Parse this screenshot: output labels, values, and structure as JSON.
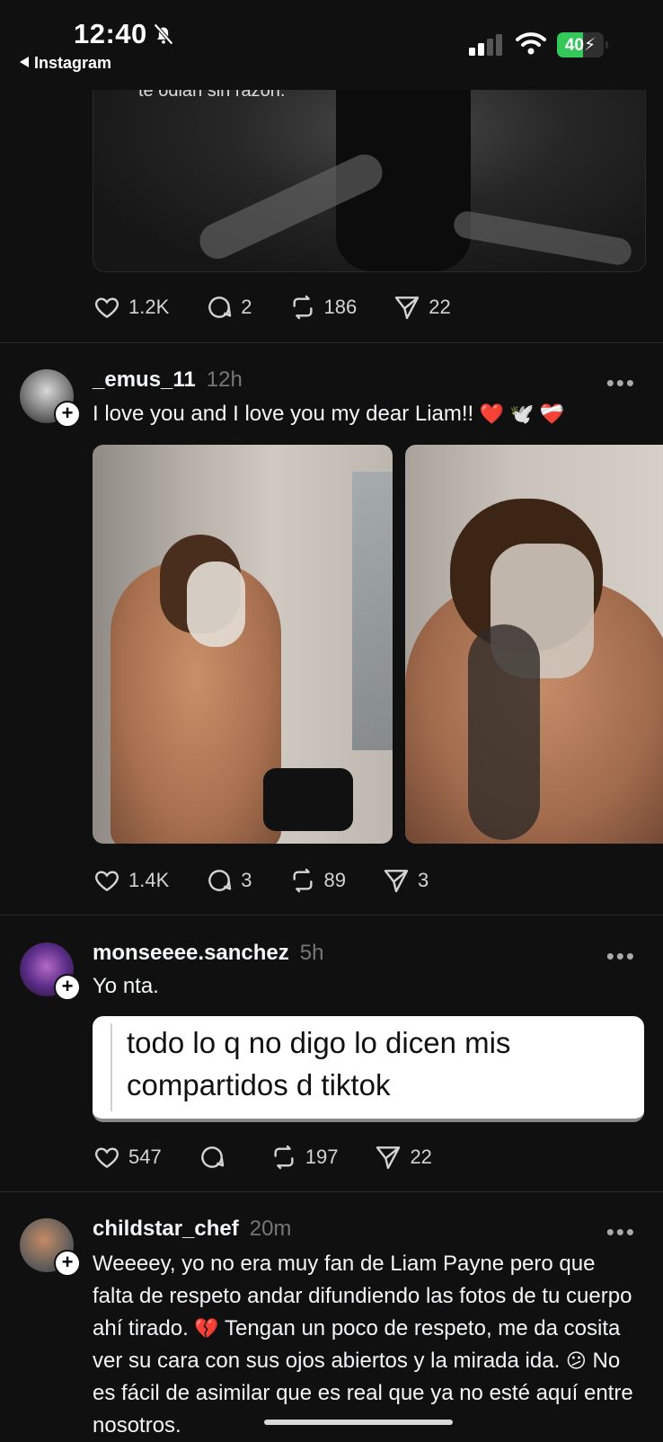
{
  "status_bar": {
    "time": "12:40",
    "back_label": "Instagram",
    "battery": "40"
  },
  "posts": [
    {
      "image_caption": "te odian sin razón.",
      "likes": "1.2K",
      "comments": "2",
      "reposts": "186",
      "shares": "22"
    },
    {
      "username": "_emus_11",
      "time": "12h",
      "text": "I love you and I love you my dear Liam!!",
      "emojis": "❤️ 🕊️ ❤️‍🩹",
      "likes": "1.4K",
      "comments": "3",
      "reposts": "89",
      "shares": "3"
    },
    {
      "username": "monseeee.sanchez",
      "time": "5h",
      "text": "Yo nta.",
      "quote": "todo lo q no digo lo dicen mis compartidos d tiktok",
      "likes": "547",
      "comments": "",
      "reposts": "197",
      "shares": "22"
    },
    {
      "username": "childstar_chef",
      "time": "20m",
      "text_part1": "Weeeey, yo no era muy fan de Liam Payne pero que falta de respeto andar difundiendo las fotos de tu cuerpo ahí tirado.",
      "emoji1": "💔",
      "text_part2": "Tengan un poco de respeto, me da cosita ver su cara con sus ojos abiertos y la mirada ida.",
      "emoji2": "😕",
      "text_part3": "No es fácil de asimilar que es real que ya no esté aquí entre nosotros."
    }
  ],
  "more_label": "•••"
}
